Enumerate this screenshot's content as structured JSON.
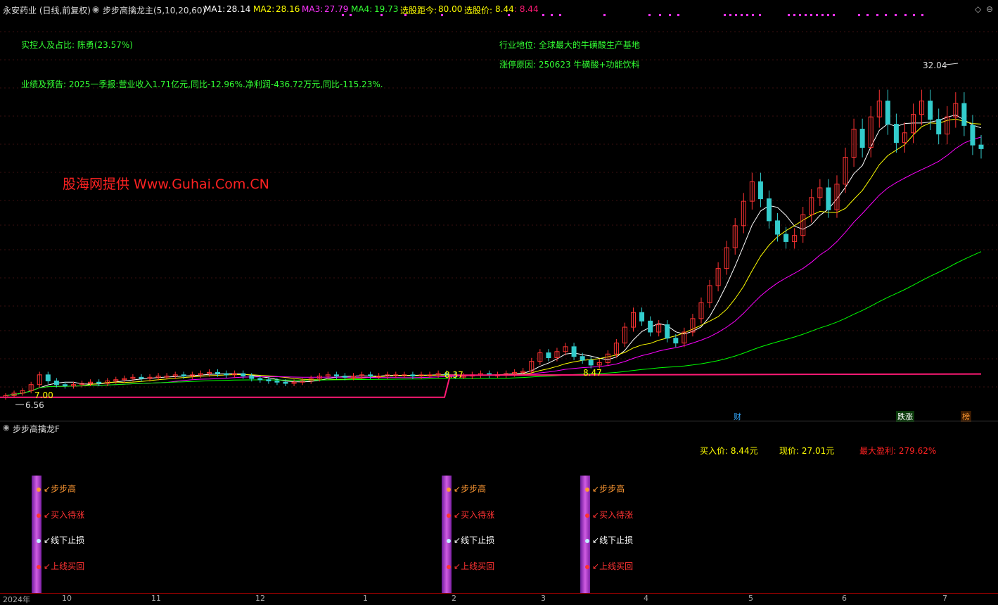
{
  "header": {
    "stock_name": "永安药业 (日线,前复权)",
    "indicator_name": "步步高擒龙主(5,10,20,60)",
    "ma1_label": "MA1:",
    "ma1_value": "28.14",
    "ma2_label": "MA2:",
    "ma2_value": "28.16",
    "ma3_label": "MA3:",
    "ma3_value": "27.79",
    "ma4_label": "MA4:",
    "ma4_value": "19.73",
    "distance_label": "选股距今:",
    "distance_value": "80.00",
    "price_label": "选股价:",
    "price_value": "8.44",
    "price_value2": ": 8.44"
  },
  "info": {
    "controller": "实控人及占比: 陈勇(23.57%)",
    "performance": "业绩及预告: 2025一季报:营业收入1.71亿元,同比-12.96%.净利润-436.72万元,同比-115.23%.",
    "industry": "行业地位: 全球最大的牛磺酸生产基地",
    "limit_reason": "涨停原因: 250623 牛磺酸+功能饮料",
    "watermark": "股海网提供 Www.Guhai.Com.CN"
  },
  "price_labels": {
    "high": "32.04",
    "low": "6.56",
    "level1": "7.00",
    "level2": "8.37",
    "level3": "8.47"
  },
  "badges": {
    "cai": "财",
    "diezhang": "跌涨",
    "bang": "榜"
  },
  "sub_panel": {
    "title": "步步高擒龙F",
    "buy_price": "买入价: 8.44元",
    "current_price": "现价: 27.01元",
    "max_profit": "最大盈利: 279.62%",
    "signals": [
      "步步高",
      "买入待涨",
      "线下止损",
      "上线买回"
    ]
  },
  "time_axis": [
    "2024年",
    "10",
    "11",
    "12",
    "1",
    "2",
    "3",
    "4",
    "5",
    "6",
    "7"
  ],
  "colors": {
    "ma1": "#ffffff",
    "ma2": "#ffff00",
    "ma3": "#ff00ff",
    "ma4": "#00ff00",
    "up": "#ff3333",
    "down": "#33cccc",
    "support": "#ff1a75",
    "info_text": "#33ff33",
    "watermark": "#ff2222"
  },
  "chart_data": {
    "type": "candlestick",
    "ylim": [
      5.8,
      34
    ],
    "ma_periods": [
      5,
      10,
      20,
      60
    ],
    "close": [
      6.7,
      6.9,
      7.1,
      7.6,
      8.4,
      7.9,
      7.6,
      7.5,
      7.6,
      7.7,
      7.8,
      7.7,
      7.9,
      8.0,
      8.1,
      8.2,
      8.1,
      8.2,
      8.3,
      8.3,
      8.4,
      8.3,
      8.4,
      8.5,
      8.6,
      8.5,
      8.4,
      8.5,
      8.3,
      8.1,
      8.0,
      7.9,
      7.8,
      7.7,
      7.8,
      7.9,
      8.1,
      8.3,
      8.4,
      8.3,
      8.2,
      8.3,
      8.4,
      8.3,
      8.3,
      8.4,
      8.4,
      8.4,
      8.3,
      8.4,
      8.4,
      8.5,
      8.4,
      8.3,
      8.3,
      8.4,
      8.5,
      8.4,
      8.4,
      8.5,
      8.6,
      8.7,
      9.5,
      10.2,
      9.8,
      10.3,
      10.7,
      9.9,
      9.6,
      9.2,
      9.4,
      10.1,
      11.0,
      12.3,
      13.5,
      12.8,
      11.9,
      12.5,
      11.4,
      11.0,
      11.9,
      13.0,
      14.3,
      15.7,
      17.1,
      18.8,
      20.6,
      22.6,
      24.2,
      22.8,
      21.0,
      19.9,
      19.3,
      19.8,
      21.5,
      22.9,
      23.7,
      21.9,
      24.0,
      26.2,
      28.5,
      27.0,
      29.5,
      30.8,
      28.9,
      27.4,
      28.2,
      29.7,
      30.8,
      29.3,
      28.1,
      29.5,
      30.6,
      28.8,
      27.2,
      26.9
    ],
    "support_line": {
      "segments": [
        [
          6.56,
          8.37
        ],
        [
          8.37,
          8.47
        ]
      ]
    }
  }
}
